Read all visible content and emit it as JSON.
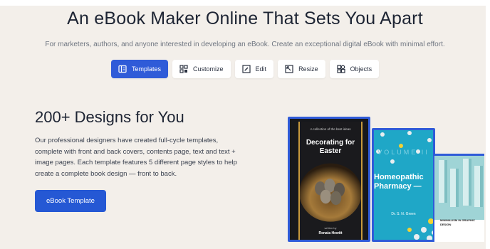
{
  "hero": {
    "title": "An eBook Maker Online That Sets You Apart",
    "subtitle": "For marketers, authors, and anyone interested in developing an eBook. Create an exceptional digital eBook with minimal effort."
  },
  "tabs": [
    {
      "label": "Templates",
      "icon": "templates-icon",
      "active": true
    },
    {
      "label": "Customize",
      "icon": "customize-icon",
      "active": false
    },
    {
      "label": "Edit",
      "icon": "edit-icon",
      "active": false
    },
    {
      "label": "Resize",
      "icon": "resize-icon",
      "active": false
    },
    {
      "label": "Objects",
      "icon": "objects-icon",
      "active": false
    }
  ],
  "section": {
    "title": "200+ Designs for You",
    "body": "Our professional designers have created full-cycle templates, complete with front and back covers, contents page, text and text + image pages. Each template features 5 different page styles to help create a complete book design — front to back.",
    "cta_label": "eBook Template"
  },
  "covers": [
    {
      "small": "A collection of the best ideas",
      "title": "Decorating for Easter",
      "by": "written by",
      "author": "Renata Hewitt"
    },
    {
      "volume": "VOLUME II",
      "title": "Homeopathic Pharmacy —",
      "author": "Dr. S. N. Green"
    },
    {
      "title": "MINIMALISM IN GRAPHIC DESIGN"
    }
  ],
  "colors": {
    "accent": "#2f5bd8",
    "background": "#f3efea",
    "cover2": "#1fa7c7"
  }
}
